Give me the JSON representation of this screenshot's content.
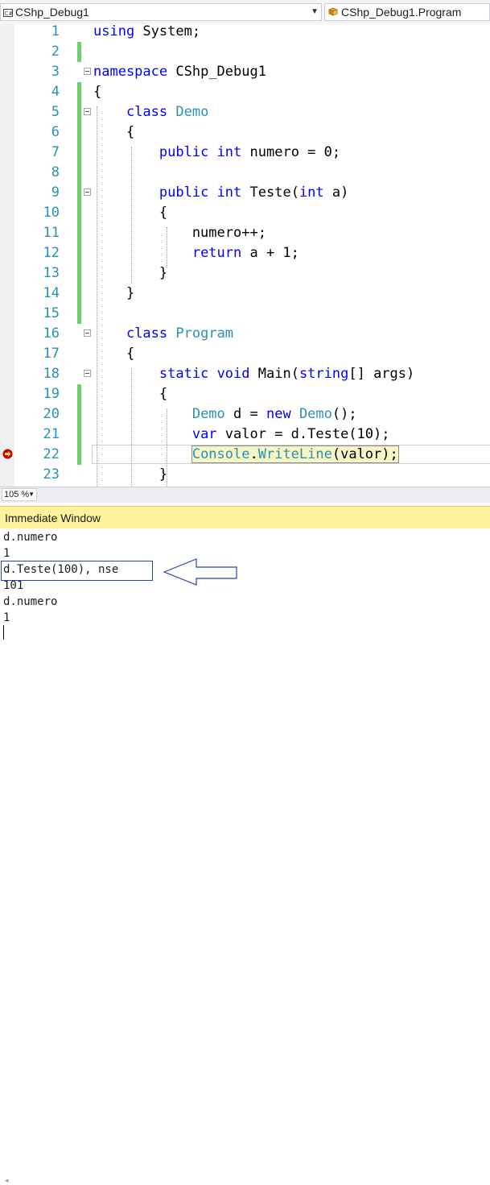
{
  "nav": {
    "left_combo": "CShp_Debug1",
    "right_combo": "CShp_Debug1.Program"
  },
  "editor": {
    "current_line": 22,
    "lines": [
      {
        "n": "1",
        "tokens": [
          {
            "t": "using",
            "c": "kw"
          },
          {
            "t": " System;"
          }
        ]
      },
      {
        "n": "2",
        "tokens": []
      },
      {
        "n": "3",
        "tokens": [
          {
            "t": "namespace",
            "c": "kw"
          },
          {
            "t": " CShp_Debug1"
          }
        ]
      },
      {
        "n": "4",
        "tokens": [
          {
            "t": "{"
          }
        ]
      },
      {
        "n": "5",
        "tokens": [
          {
            "t": "    "
          },
          {
            "t": "class",
            "c": "kw"
          },
          {
            "t": " "
          },
          {
            "t": "Demo",
            "c": "ty"
          }
        ]
      },
      {
        "n": "6",
        "tokens": [
          {
            "t": "    {"
          }
        ]
      },
      {
        "n": "7",
        "tokens": [
          {
            "t": "        "
          },
          {
            "t": "public",
            "c": "kw"
          },
          {
            "t": " "
          },
          {
            "t": "int",
            "c": "kw"
          },
          {
            "t": " numero = 0;"
          }
        ]
      },
      {
        "n": "8",
        "tokens": []
      },
      {
        "n": "9",
        "tokens": [
          {
            "t": "        "
          },
          {
            "t": "public",
            "c": "kw"
          },
          {
            "t": " "
          },
          {
            "t": "int",
            "c": "kw"
          },
          {
            "t": " Teste("
          },
          {
            "t": "int",
            "c": "kw"
          },
          {
            "t": " a)"
          }
        ]
      },
      {
        "n": "10",
        "tokens": [
          {
            "t": "        {"
          }
        ]
      },
      {
        "n": "11",
        "tokens": [
          {
            "t": "            numero++;"
          }
        ]
      },
      {
        "n": "12",
        "tokens": [
          {
            "t": "            "
          },
          {
            "t": "return",
            "c": "kw"
          },
          {
            "t": " a + 1;"
          }
        ]
      },
      {
        "n": "13",
        "tokens": [
          {
            "t": "        }"
          }
        ]
      },
      {
        "n": "14",
        "tokens": [
          {
            "t": "    }"
          }
        ]
      },
      {
        "n": "15",
        "tokens": []
      },
      {
        "n": "16",
        "tokens": [
          {
            "t": "    "
          },
          {
            "t": "class",
            "c": "kw"
          },
          {
            "t": " "
          },
          {
            "t": "Program",
            "c": "ty"
          }
        ]
      },
      {
        "n": "17",
        "tokens": [
          {
            "t": "    {"
          }
        ]
      },
      {
        "n": "18",
        "tokens": [
          {
            "t": "        "
          },
          {
            "t": "static",
            "c": "kw"
          },
          {
            "t": " "
          },
          {
            "t": "void",
            "c": "kw"
          },
          {
            "t": " Main("
          },
          {
            "t": "string",
            "c": "kw"
          },
          {
            "t": "[] args)"
          }
        ]
      },
      {
        "n": "19",
        "tokens": [
          {
            "t": "        {"
          }
        ]
      },
      {
        "n": "20",
        "tokens": [
          {
            "t": "            "
          },
          {
            "t": "Demo",
            "c": "ty"
          },
          {
            "t": " d = "
          },
          {
            "t": "new",
            "c": "kw"
          },
          {
            "t": " "
          },
          {
            "t": "Demo",
            "c": "ty"
          },
          {
            "t": "();"
          }
        ]
      },
      {
        "n": "21",
        "tokens": [
          {
            "t": "            "
          },
          {
            "t": "var",
            "c": "kw"
          },
          {
            "t": " valor = d.Teste(10);"
          }
        ]
      },
      {
        "n": "22",
        "tokens": [
          {
            "t": "            "
          },
          {
            "t": "Console",
            "c": "ty",
            "stmt": true
          },
          {
            "t": ".",
            "stmt": true
          },
          {
            "t": "WriteLine",
            "stmt": true,
            "c": "ty"
          },
          {
            "t": "(valor);",
            "stmt": true
          }
        ]
      },
      {
        "n": "23",
        "tokens": [
          {
            "t": "        }"
          }
        ]
      }
    ]
  },
  "zoom": "105 %",
  "immediate": {
    "title": "Immediate Window",
    "lines": [
      "d.numero",
      "1",
      "d.Teste(100), nse",
      "101",
      "d.numero",
      "1"
    ]
  },
  "colors": {
    "keyword": "#0000ff",
    "type": "#2b91af",
    "change_bar": "#6ed36e",
    "immediate_title_bg": "#fff29d",
    "annotation": "#2a45a8"
  }
}
